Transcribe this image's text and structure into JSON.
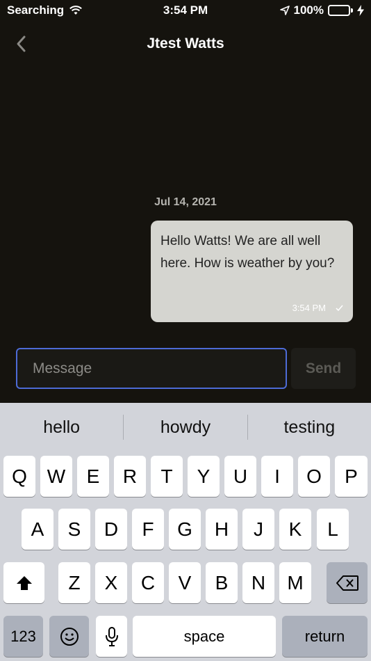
{
  "status_bar": {
    "carrier": "Searching",
    "time": "3:54 PM",
    "battery": "100%"
  },
  "nav": {
    "title": "Jtest Watts"
  },
  "conversation": {
    "date": "Jul 14, 2021",
    "messages": [
      {
        "text": "Hello Watts! We are all well here. How is weather by you?",
        "time": "3:54 PM",
        "status_icon": "checkmark-icon",
        "direction": "outgoing"
      }
    ]
  },
  "composer": {
    "placeholder": "Message",
    "value": "",
    "send_label": "Send"
  },
  "keyboard": {
    "suggestions": [
      "hello",
      "howdy",
      "testing"
    ],
    "row1": [
      "Q",
      "W",
      "E",
      "R",
      "T",
      "Y",
      "U",
      "I",
      "O",
      "P"
    ],
    "row2": [
      "A",
      "S",
      "D",
      "F",
      "G",
      "H",
      "J",
      "K",
      "L"
    ],
    "row3": [
      "Z",
      "X",
      "C",
      "V",
      "B",
      "N",
      "M"
    ],
    "numbers_label": "123",
    "space_label": "space",
    "return_label": "return"
  },
  "colors": {
    "background": "#15130e",
    "bubble": "#d5d5d0",
    "input_border": "#4d6bd6",
    "battery": "#4cd964",
    "keyboard": "#d2d4da"
  }
}
